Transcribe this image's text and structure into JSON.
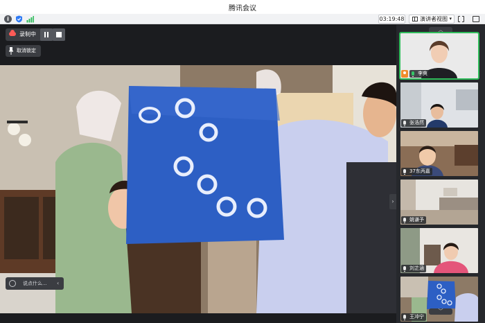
{
  "app": {
    "title": "腾讯会议"
  },
  "toolbar": {
    "timer": "03:19:48",
    "view_label": "演讲者视图",
    "view_caret": "▾"
  },
  "main": {
    "recording_label": "录制中",
    "unpin_label": "取消锁定",
    "chat_placeholder": "说点什么...",
    "chat_collapse": "‹",
    "side_toggle": "›"
  },
  "gallery": {
    "scroll_up": "︿",
    "scroll_down": "﹀",
    "participants": [
      {
        "name": "李爽",
        "host": true,
        "mic": "on"
      },
      {
        "name": "张浩然",
        "host": false,
        "mic": "off"
      },
      {
        "name": "37东丙嘉",
        "host": false,
        "mic": "off"
      },
      {
        "name": "姚谦予",
        "host": false,
        "mic": "off"
      },
      {
        "name": "刘芷涵",
        "host": false,
        "mic": "off"
      },
      {
        "name": "王冲宁",
        "host": false,
        "mic": "off"
      }
    ]
  },
  "colors": {
    "accent_green": "#2fbc5a",
    "record_red": "#ff5b57",
    "host_orange": "#f08c2c"
  }
}
